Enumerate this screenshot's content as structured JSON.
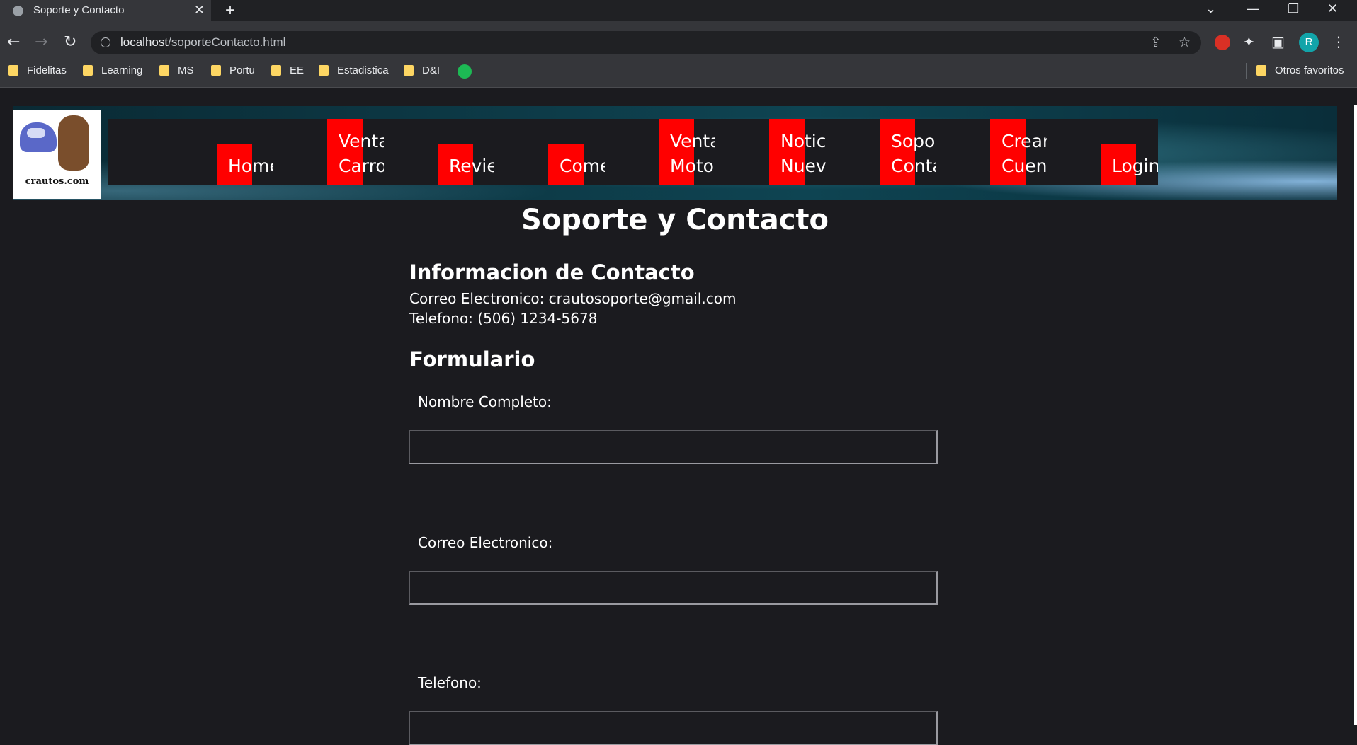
{
  "browser": {
    "tab_title": "Soporte y Contacto",
    "tab_close": "✕",
    "new_tab": "+",
    "url_host": "localhost",
    "url_path": "/soporteContacto.html",
    "profile_initial": "R",
    "bookmarks": [
      "Fidelitas",
      "Learning",
      "MS",
      "Portu",
      "EE",
      "Estadistica",
      "D&I"
    ],
    "other_bookmarks": "Otros favoritos"
  },
  "site": {
    "logo_text": "crautos.com",
    "menu": [
      {
        "label": "Home"
      },
      {
        "label": "Venta\nCarro"
      },
      {
        "label": "Revie"
      },
      {
        "label": "Comer"
      },
      {
        "label": "Venta\nMotos"
      },
      {
        "label": "Notic\nNuevo"
      },
      {
        "label": "Sopor\nConta"
      },
      {
        "label": "Crear\nCuent"
      },
      {
        "label": "Login"
      }
    ]
  },
  "page": {
    "title": "Soporte y Contacto",
    "contact": {
      "heading": "Informacion de Contacto",
      "email_line": "Correo Electronico: crautosoporte@gmail.com",
      "phone_line": "Telefono: (506) 1234-5678"
    },
    "form": {
      "heading": "Formulario",
      "fields": [
        {
          "label": "Nombre Completo:",
          "value": ""
        },
        {
          "label": "Correo Electronico:",
          "value": ""
        },
        {
          "label": "Telefono:",
          "value": ""
        }
      ]
    }
  },
  "colors": {
    "menu_accent": "#ff0000",
    "page_background": "#1b1b1f"
  }
}
